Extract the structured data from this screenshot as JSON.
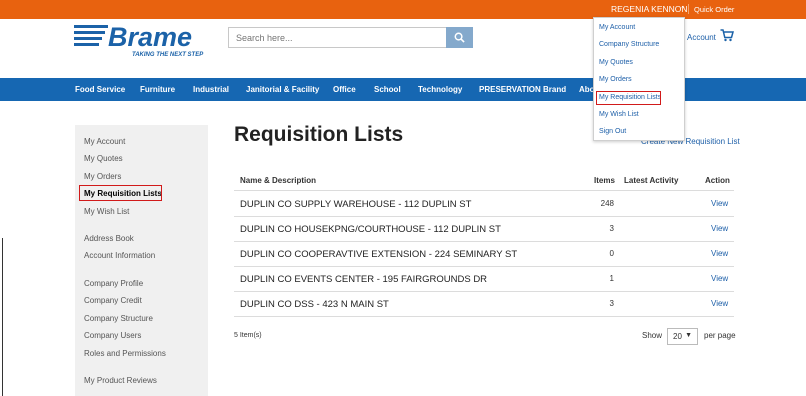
{
  "header": {
    "user_name": "REGENIA KENNON",
    "quick_order": "Quick Order",
    "search_placeholder": "Search here...",
    "account_label": "Account",
    "logo_text": "Brame",
    "logo_tagline": "TAKING THE NEXT STEP"
  },
  "user_menu": {
    "items": [
      "My Account",
      "Company Structure",
      "My Quotes",
      "My Orders",
      "My Requisition Lists",
      "My Wish List",
      "Sign Out"
    ]
  },
  "nav": {
    "items": [
      "Food Service",
      "Furniture",
      "Industrial",
      "Janitorial & Facility",
      "Office",
      "School",
      "Technology",
      "PRESERVATION Brand",
      "Abo"
    ]
  },
  "sidebar": {
    "items": [
      "My Account",
      "My Quotes",
      "My Orders",
      "My Requisition Lists",
      "My Wish List",
      "Address Book",
      "Account Information",
      "Company Profile",
      "Company Credit",
      "Company Structure",
      "Company Users",
      "Roles and Permissions",
      "My Product Reviews"
    ],
    "active": "My Requisition Lists"
  },
  "main": {
    "title": "Requisition Lists",
    "create_link": "Create New Requisition List",
    "table": {
      "headers": [
        "Name & Description",
        "Items",
        "Latest Activity",
        "Action"
      ],
      "rows": [
        {
          "name": "DUPLIN CO SUPPLY WAREHOUSE - 112 DUPLIN ST",
          "items": "248",
          "activity": "",
          "action": "View"
        },
        {
          "name": "DUPLIN CO HOUSEKPNG/COURTHOUSE - 112 DUPLIN ST",
          "items": "3",
          "activity": "",
          "action": "View"
        },
        {
          "name": "DUPLIN CO COOPERAVTIVE EXTENSION - 224 SEMINARY ST",
          "items": "0",
          "activity": "",
          "action": "View"
        },
        {
          "name": "DUPLIN CO EVENTS CENTER - 195 FAIRGROUNDS DR",
          "items": "1",
          "activity": "",
          "action": "View"
        },
        {
          "name": "DUPLIN CO DSS - 423 N MAIN ST",
          "items": "3",
          "activity": "",
          "action": "View"
        }
      ]
    },
    "item_count": "5 Item(s)",
    "show_label": "Show",
    "per_page_value": "20",
    "per_page_label": "per page"
  },
  "colors": {
    "topbar": "#e8620f",
    "nav": "#1667b2",
    "link": "#1d5fa8",
    "highlight": "#d11a1a"
  }
}
